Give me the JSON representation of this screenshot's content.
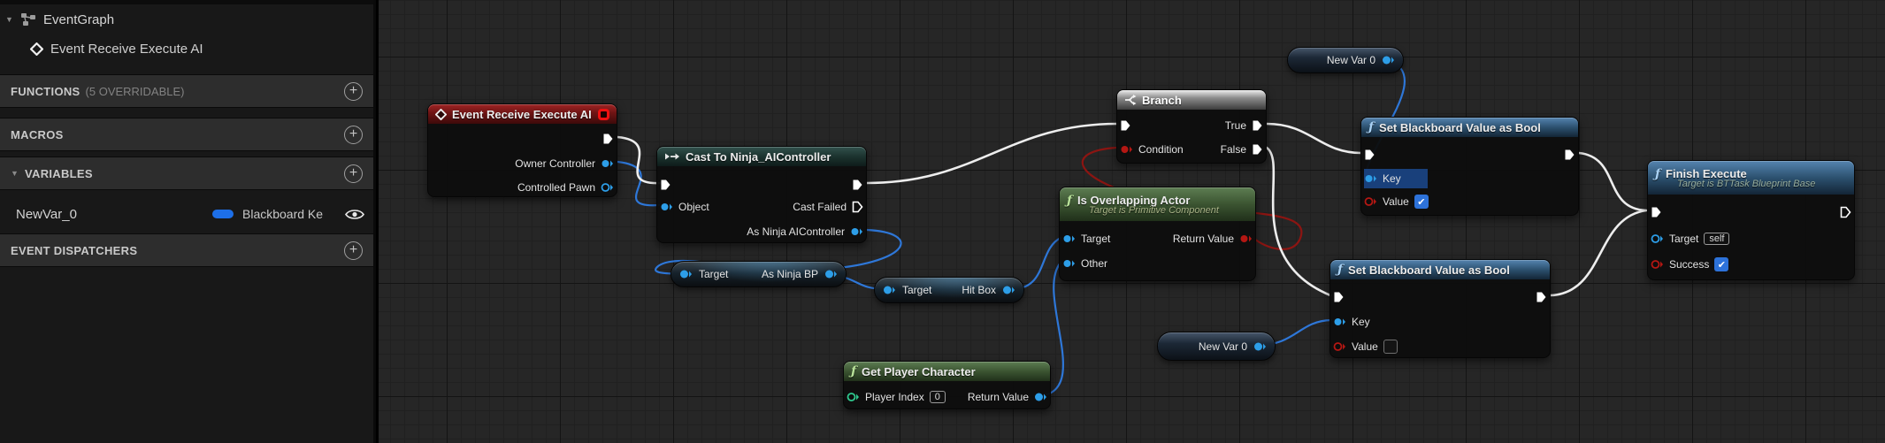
{
  "sidebar": {
    "event_graph_label": "EventGraph",
    "event_item_label": "Event Receive Execute AI",
    "functions": {
      "label": "FUNCTIONS",
      "sub": "(5 OVERRIDABLE)"
    },
    "macros": {
      "label": "MACROS"
    },
    "variables": {
      "label": "VARIABLES"
    },
    "event_dispatchers": {
      "label": "EVENT DISPATCHERS"
    },
    "variable": {
      "name": "NewVar_0",
      "type": "Blackboard Ke"
    }
  },
  "nodes": {
    "event": {
      "title": "Event Receive Execute AI",
      "owner": "Owner Controller",
      "pawn": "Controlled Pawn"
    },
    "cast": {
      "title": "Cast To Ninja_AIController",
      "object": "Object",
      "cast_failed": "Cast Failed",
      "as_ctrl": "As Ninja AIController"
    },
    "branch": {
      "title": "Branch",
      "condition": "Condition",
      "true": "True",
      "false": "False"
    },
    "newvar_top": {
      "label": "New Var 0"
    },
    "newvar_bottom": {
      "label": "New Var 0"
    },
    "overlap": {
      "title": "Is Overlapping Actor",
      "subtitle": "Target is Primitive Component",
      "target": "Target",
      "other": "Other",
      "ret": "Return Value"
    },
    "set1": {
      "title": "Set Blackboard Value as Bool",
      "key": "Key",
      "value": "Value"
    },
    "set2": {
      "title": "Set Blackboard Value as Bool",
      "key": "Key",
      "value": "Value"
    },
    "finish": {
      "title": "Finish Execute",
      "subtitle": "Target is BTTask Blueprint Base",
      "target": "Target",
      "target_value": "self",
      "success": "Success"
    },
    "get_player": {
      "title": "Get Player Character",
      "index": "Player Index",
      "index_value": "0",
      "ret": "Return Value"
    },
    "ninja_bp": {
      "target": "Target",
      "out": "As Ninja BP"
    },
    "hit_box": {
      "target": "Target",
      "out": "Hit Box"
    }
  },
  "icons": {
    "plus": "+",
    "check": "✔",
    "fn_glyph": "ƒ",
    "collapse_arrow": "▼"
  },
  "colors": {
    "wire_exec": "#ededed",
    "wire_object": "#2e77d8",
    "wire_bool": "#8c1512",
    "pin_object": "#2d9ee8",
    "pin_bool": "#b41713",
    "pin_int": "#2fc98f",
    "var_type_pill": "#1d6fe8"
  }
}
